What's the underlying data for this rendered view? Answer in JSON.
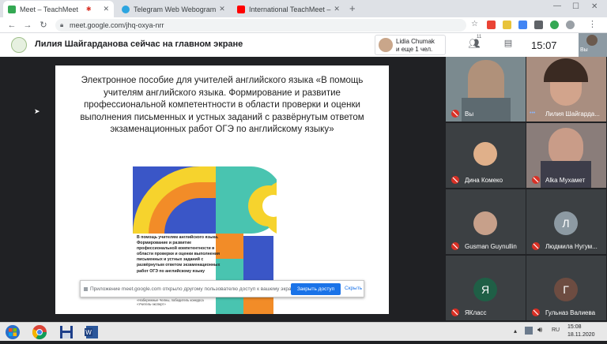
{
  "browser": {
    "tabs": [
      {
        "label": "Meet – TeachMeet",
        "active": true
      },
      {
        "label": "Telegram Web Webogram",
        "active": false
      },
      {
        "label": "International TeachMeet –",
        "active": false
      }
    ],
    "url": "meet.google.com/jhq-oxya-nrr"
  },
  "meet": {
    "presenter_title": "Лилия Шайгарданова сейчас на главном экране",
    "viewers_line1": "Lidia Chumak",
    "viewers_line2": "и еще 1 чел.",
    "people_count": "11",
    "clock": "15:07",
    "self_label": "Вы"
  },
  "slide": {
    "text": "Электронное пособие для учителей английского языка «В помощь учителям английского языка. Формирование и развитие профессиональной компетентности в области проверки и оценки выполнения письменных и устных заданий с развёрнутым ответом экзаменационных работ ОГЭ по английскому языку»",
    "book_blurb": "В помощь учителям английского языка. Формирование и развитие профессиональной компетентности в области проверки и оценки выполнения письменных и устных заданий с развёрнутым ответом экзаменационных работ ОГЭ по английскому языку",
    "book_bottom": "Автор: учителя английского языка МБОУ «Набережные Челны, победитель конкурса «Учитель-эксперт»"
  },
  "share_notice": {
    "text": "Приложение meet.google.com открыло другому пользователю доступ к вашему экрану.",
    "stop_label": "Закрыть доступ",
    "hide_label": "Скрыть"
  },
  "participants": [
    {
      "name": "Вы",
      "kind": "video"
    },
    {
      "name": "Лилия Шайгарда...",
      "kind": "video"
    },
    {
      "name": "Дина Комеко",
      "kind": "photo"
    },
    {
      "name": "Alka Мухамет",
      "kind": "video"
    },
    {
      "name": "Gusman Guynullin",
      "kind": "photo"
    },
    {
      "name": "Людмила Нугум...",
      "kind": "letter",
      "letter": "Л",
      "color": "#8d9aa3"
    },
    {
      "name": "ЯКласс",
      "kind": "letter",
      "letter": "Я",
      "color": "#1f5f46"
    },
    {
      "name": "Гульназ Валиева",
      "kind": "letter",
      "letter": "Г",
      "color": "#6d4c41"
    }
  ],
  "taskbar": {
    "time": "15:08",
    "date": "18.11.2020"
  },
  "colors": {
    "accent": "#1a73e8",
    "mute_red": "#d93025",
    "book_orange": "#f28c28",
    "book_blue": "#3a56c7",
    "book_teal": "#49c4b0",
    "book_yellow": "#f6d32d"
  }
}
